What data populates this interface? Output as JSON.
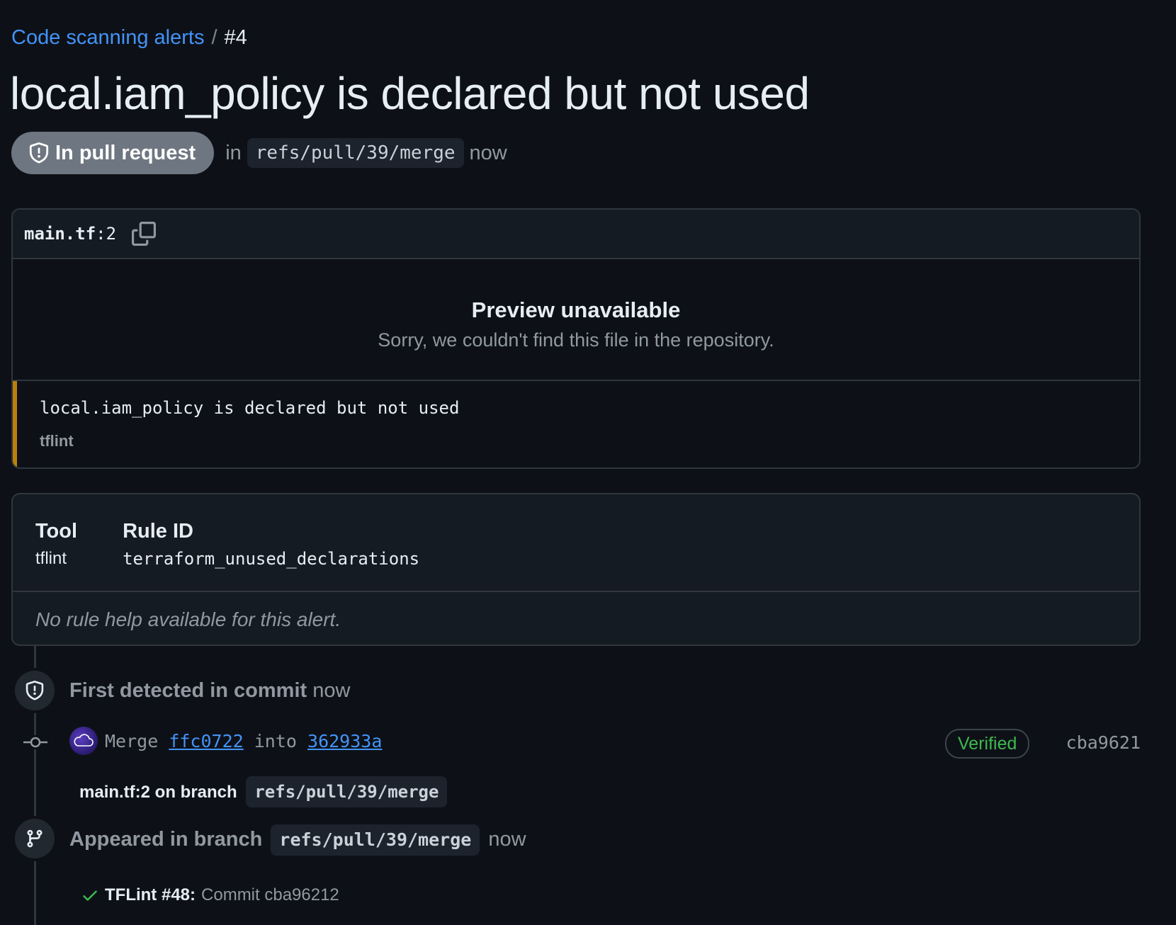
{
  "breadcrumb": {
    "parent": "Code scanning alerts",
    "separator": "/",
    "current": "#4"
  },
  "alert": {
    "title": "local.iam_policy is declared but not used",
    "state": "In pull request",
    "in_label": "in",
    "ref": "refs/pull/39/merge",
    "time": "now"
  },
  "file": {
    "name": "main.tf",
    "line_suffix": ":2",
    "preview_title": "Preview unavailable",
    "preview_desc": "Sorry, we couldn't find this file in the repository.",
    "message": "local.iam_policy is declared but not used",
    "tool": "tflint"
  },
  "rule": {
    "tool_label": "Tool",
    "tool_value": "tflint",
    "rule_id_label": "Rule ID",
    "rule_id_value": "terraform_unused_declarations",
    "help_text": "No rule help available for this alert."
  },
  "timeline": {
    "first_detected": {
      "label": "First detected in commit",
      "time": "now"
    },
    "commit": {
      "prefix": "Merge",
      "sha_from": "ffc0722",
      "into": "into",
      "sha_to": "362933a",
      "verified": "Verified",
      "short_sha": "cba9621"
    },
    "location": {
      "text": "main.tf:2 on branch",
      "ref": "refs/pull/39/merge"
    },
    "appeared": {
      "label": "Appeared in branch",
      "ref": "refs/pull/39/merge",
      "time": "now"
    },
    "check": {
      "name": "TFLint #48:",
      "desc": "Commit cba96212"
    }
  },
  "colors": {
    "background": "#0d1117",
    "link": "#4493f8",
    "warning_bar": "#bb8009",
    "verified": "#3fb950",
    "state_pill": "#6e7681"
  },
  "icons": {
    "state": "shield-alert-icon",
    "copy": "copy-icon",
    "detected": "shield-alert-icon",
    "commit": "git-commit-icon",
    "branch": "git-branch-icon",
    "check": "check-icon"
  }
}
